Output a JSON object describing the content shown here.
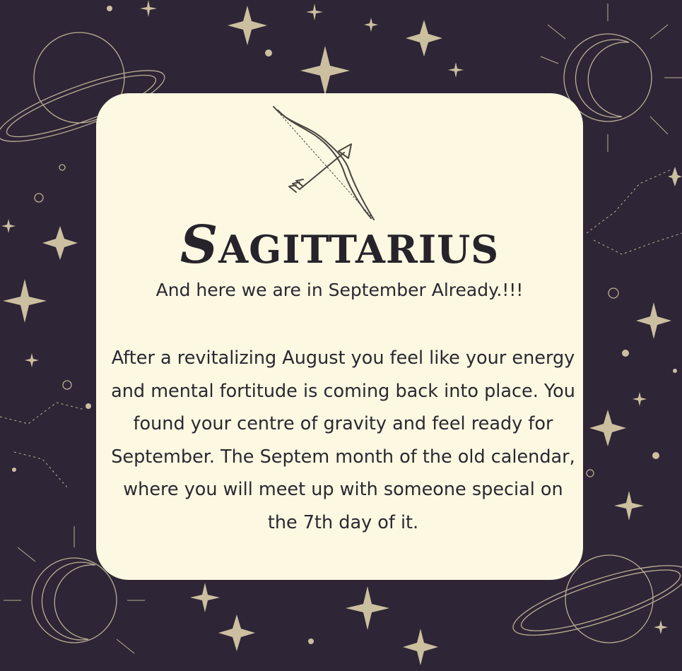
{
  "background_color": "#2e2536",
  "card_color": "#fdf8e2",
  "ornament_color": "#cbbfa0",
  "icon": "bow-and-arrow-icon",
  "title": "Sagittarius",
  "title_first": "S",
  "title_rest": "AGITTARIUS",
  "subtitle": "And here we are in September Already.!!!",
  "body": "After a revitalizing August you feel like your energy and mental fortitude is coming back into place. You found your centre of gravity and feel ready for September. The Septem month of the old calendar, where you will meet up with someone special on the 7th day of it."
}
